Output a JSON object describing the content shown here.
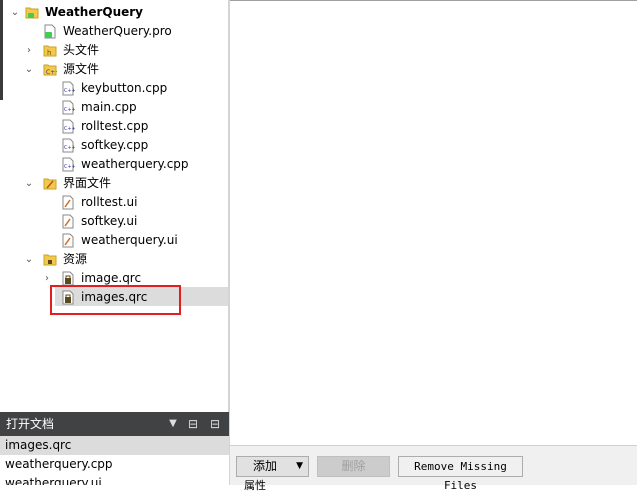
{
  "project_tree": {
    "root": "WeatherQuery",
    "pro_file": "WeatherQuery.pro",
    "headers": "头文件",
    "sources": {
      "label": "源文件",
      "files": [
        "keybutton.cpp",
        "main.cpp",
        "rolltest.cpp",
        "softkey.cpp",
        "weatherquery.cpp"
      ]
    },
    "forms": {
      "label": "界面文件",
      "files": [
        "rolltest.ui",
        "softkey.ui",
        "weatherquery.ui"
      ]
    },
    "resources": {
      "label": "资源",
      "files": [
        "image.qrc",
        "images.qrc"
      ]
    }
  },
  "open_documents": {
    "title": "打开文档",
    "items": [
      "images.qrc",
      "weatherquery.cpp",
      "weatherquery.ui"
    ]
  },
  "resource_editor": {
    "add_label": "添加",
    "remove_label": "删除",
    "remove_missing_label": "Remove Missing Files",
    "lower_label": "属性"
  }
}
